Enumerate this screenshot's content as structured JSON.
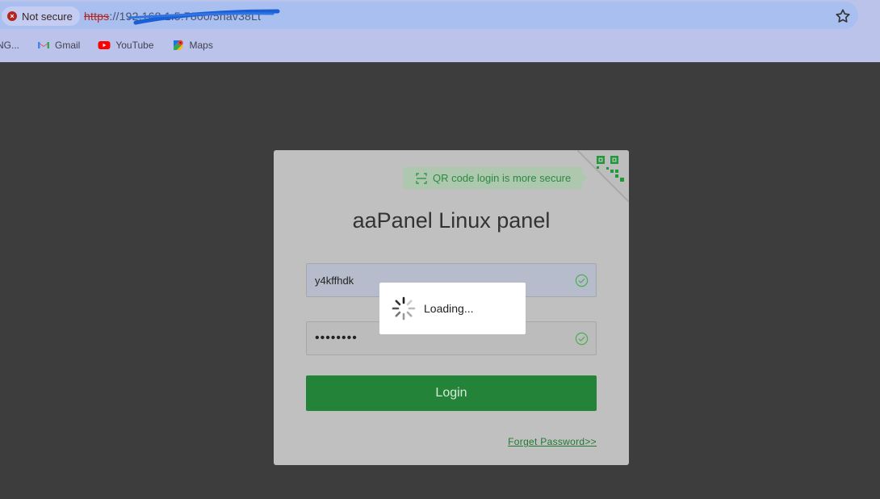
{
  "browser": {
    "security_label": "Not secure",
    "url_scheme": "https",
    "url_rest": "://192.168.1.5:7800/5hav38Lt"
  },
  "bookmarks": [
    {
      "label": "NG...",
      "icon": "folder-icon"
    },
    {
      "label": "Gmail",
      "icon": "gmail-icon"
    },
    {
      "label": "YouTube",
      "icon": "youtube-icon"
    },
    {
      "label": "Maps",
      "icon": "maps-icon"
    }
  ],
  "login": {
    "qr_hint": "QR code login is more secure",
    "title": "aaPanel Linux panel",
    "username_value": "y4kffhdk",
    "password_value": "••••••••",
    "login_label": "Login",
    "forget_label": "Forget Password>>"
  },
  "loading": {
    "text": "Loading..."
  },
  "colors": {
    "accent_green": "#238338",
    "qr_green": "#2a8a3e",
    "overlay_bg": "#3d3d3d"
  }
}
